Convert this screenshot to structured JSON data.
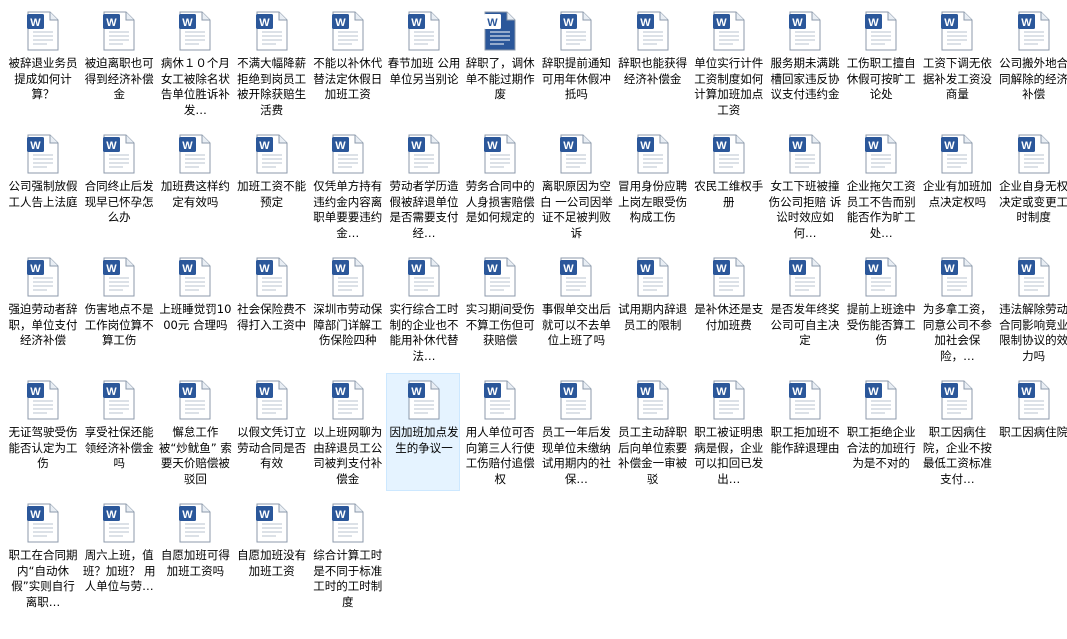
{
  "icon": "word-document-icon",
  "icon_badge_letter": "W",
  "colors": {
    "word_blue": "#2b579a",
    "selection_bg": "#e5f3ff",
    "selection_border": "#cde8ff"
  },
  "files": [
    {
      "label": "被辞退业务员提成如何计算？"
    },
    {
      "label": "被迫离职也可得到经济补偿金"
    },
    {
      "label": "病休１０个月女工被除名状告单位胜诉补发…"
    },
    {
      "label": "不满大幅降薪拒绝到岗员工被开除获赔生活费"
    },
    {
      "label": "不能以补休代替法定休假日加班工资"
    },
    {
      "label": "春节加班 公用单位另当别论"
    },
    {
      "label": "辞职了，调休单不能过期作废",
      "highlight_icon": true
    },
    {
      "label": "辞职提前通知可用年休假冲抵吗"
    },
    {
      "label": "辞职也能获得经济补偿金"
    },
    {
      "label": "单位实行计件工资制度如何计算加班加点工资"
    },
    {
      "label": "服务期未满跳槽回家违反协议支付违约金"
    },
    {
      "label": "工伤职工擅自休假可按旷工论处"
    },
    {
      "label": "工资下调无依据补发工资没商量"
    },
    {
      "label": "公司搬外地合同解除的经济补偿"
    },
    {
      "label": "公司强制放假工人告上法庭"
    },
    {
      "label": "合同终止后发现早已怀孕怎么办"
    },
    {
      "label": "加班费这样约定有效吗"
    },
    {
      "label": "加班工资不能预定"
    },
    {
      "label": "仅凭单方持有违约金内容离职单要要违约金…"
    },
    {
      "label": "劳动者学历造假被辞退单位是否需要支付经…"
    },
    {
      "label": "劳务合同中的人身损害赔偿是如何规定的"
    },
    {
      "label": "离职原因为空白 一公司因举证不足被判败诉"
    },
    {
      "label": "冒用身份应聘上岗左眼受伤构成工伤"
    },
    {
      "label": "农民工维权手册"
    },
    {
      "label": "女工下班被撞伤公司拒赔 诉讼时效应如何…"
    },
    {
      "label": "企业拖欠工资员工不告而别能否作为旷工处…"
    },
    {
      "label": "企业有加班加点决定权吗"
    },
    {
      "label": "企业自身无权决定或变更工时制度"
    },
    {
      "label": "强迫劳动者辞职，单位支付经济补偿"
    },
    {
      "label": "伤害地点不是工作岗位算不算工伤"
    },
    {
      "label": "上班睡觉罚1000元 合理吗"
    },
    {
      "label": "社会保险费不得打入工资中"
    },
    {
      "label": "深圳市劳动保障部门详解工伤保险四种"
    },
    {
      "label": "实行综合工时制的企业也不能用补休代替法…"
    },
    {
      "label": "实习期间受伤不算工伤但可获赔偿"
    },
    {
      "label": "事假单交出后就可以不去单位上班了吗"
    },
    {
      "label": "试用期内辞退员工的限制"
    },
    {
      "label": "是补休还是支付加班费"
    },
    {
      "label": "是否发年终奖公司可自主决定"
    },
    {
      "label": "提前上班途中受伤能否算工伤"
    },
    {
      "label": "为多拿工资，同意公司不参加社会保险，…"
    },
    {
      "label": "违法解除劳动合同影响竞业限制协议的效力吗"
    },
    {
      "label": "无证驾驶受伤能否认定为工伤"
    },
    {
      "label": "享受社保还能领经济补偿金吗"
    },
    {
      "label": "懈怠工作被“炒鱿鱼” 索要天价赔偿被驳回"
    },
    {
      "label": "以假文凭订立劳动合同是否有效"
    },
    {
      "label": "以上班网聊为由辞退员工公司被判支付补偿金"
    },
    {
      "label": "因加班加点发生的争议一",
      "selected": true
    },
    {
      "label": "用人单位可否向第三人行使工伤赔付追偿权"
    },
    {
      "label": "员工一年后发现单位未缴纳试用期内的社保…"
    },
    {
      "label": "员工主动辞职后向单位索要补偿金一审被驳"
    },
    {
      "label": "职工被证明患病是假，企业可以扣回已发出…"
    },
    {
      "label": "职工拒加班不能作辞退理由"
    },
    {
      "label": "职工拒绝企业合法的加班行为是不对的"
    },
    {
      "label": "职工因病住院，企业不按最低工资标准支付…"
    },
    {
      "label": "职工因病住院"
    },
    {
      "label": "职工在合同期内“自动休假”实则自行离职…"
    },
    {
      "label": "周六上班，值班？加班？ 用人单位与劳…"
    },
    {
      "label": "自愿加班可得加班工资吗"
    },
    {
      "label": "自愿加班没有加班工资"
    },
    {
      "label": "综合计算工时是不同于标准工时的工时制度"
    }
  ]
}
